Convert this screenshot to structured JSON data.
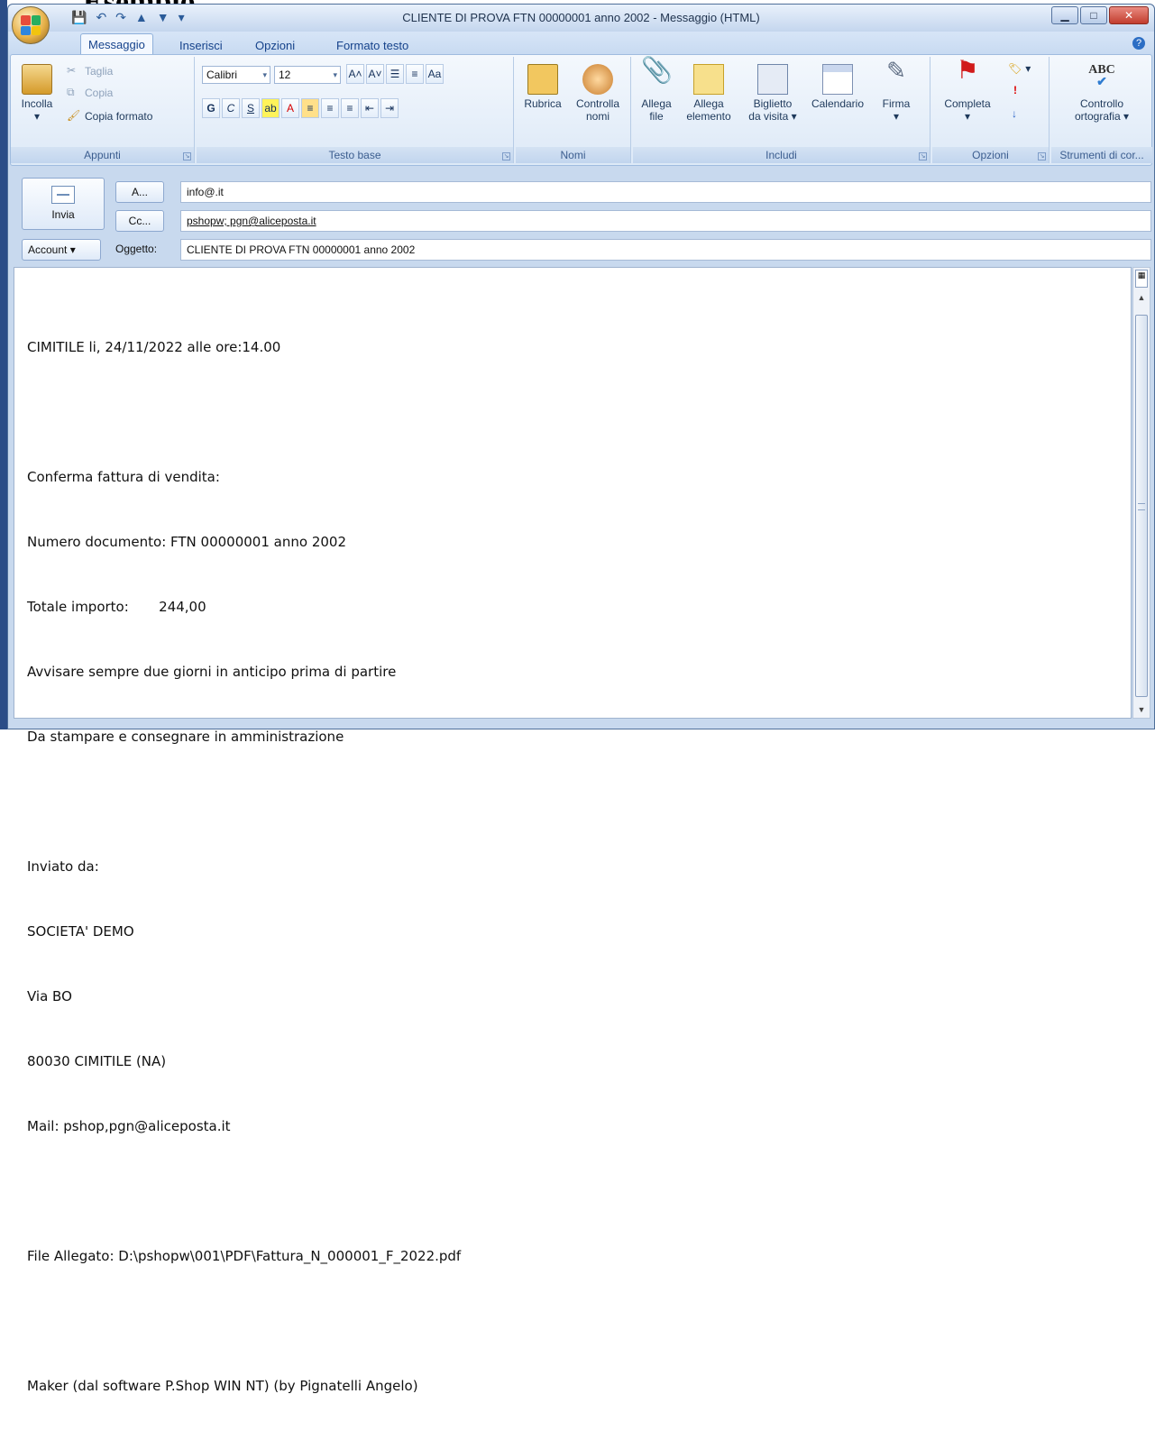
{
  "window": {
    "title": "CLIENTE DI PROVA FTN 00000001 anno 2002 - Messaggio (HTML)",
    "top_partial_text": "Esempio"
  },
  "tabs": [
    "Messaggio",
    "Inserisci",
    "Opzioni",
    "Formato testo"
  ],
  "ribbon": {
    "appunti": {
      "label": "Appunti",
      "paste": "Incolla",
      "cut": "Taglia",
      "copy": "Copia",
      "format_painter": "Copia formato"
    },
    "testo_base": {
      "label": "Testo base",
      "font": "Calibri",
      "size": "12",
      "bold": "G",
      "italic": "C",
      "underline": "S"
    },
    "nomi": {
      "label": "Nomi",
      "address_book": "Rubrica",
      "check_names_1": "Controlla",
      "check_names_2": "nomi"
    },
    "includi": {
      "label": "Includi",
      "attach_file_1": "Allega",
      "attach_file_2": "file",
      "attach_item_1": "Allega",
      "attach_item_2": "elemento",
      "business_card_1": "Biglietto",
      "business_card_2": "da visita",
      "calendar": "Calendario",
      "signature": "Firma"
    },
    "opzioni": {
      "label": "Opzioni",
      "follow_up": "Completa"
    },
    "strumenti": {
      "label": "Strumenti di cor...",
      "spelling_1": "Controllo",
      "spelling_2": "ortografia"
    }
  },
  "header": {
    "send": "Invia",
    "to_button": "A...",
    "to_value": "info@.it",
    "cc_button": "Cc...",
    "cc_value": "pshopw; pgn@aliceposta.it",
    "account": "Account",
    "subject_label": "Oggetto:",
    "subject_value": "CLIENTE DI PROVA FTN 00000001 anno 2002"
  },
  "body": {
    "lines": [
      "CIMITILE li, 24/11/2022 alle ore:14.00",
      "",
      "Conferma fattura di vendita:",
      "Numero documento: FTN 00000001 anno 2002",
      "Totale importo:       244,00",
      "Avvisare sempre due giorni in anticipo prima di partire",
      "Da stampare e consegnare in amministrazione",
      "",
      "Inviato da:",
      "SOCIETA' DEMO",
      "Via BO",
      "80030 CIMITILE (NA)",
      "Mail: pshop,pgn@aliceposta.it",
      "",
      "File Allegato: D:\\pshopw\\001\\PDF\\Fattura_N_000001_F_2022.pdf",
      "",
      "Maker (dal software P.Shop WIN NT) (by Pignatelli Angelo)"
    ]
  }
}
